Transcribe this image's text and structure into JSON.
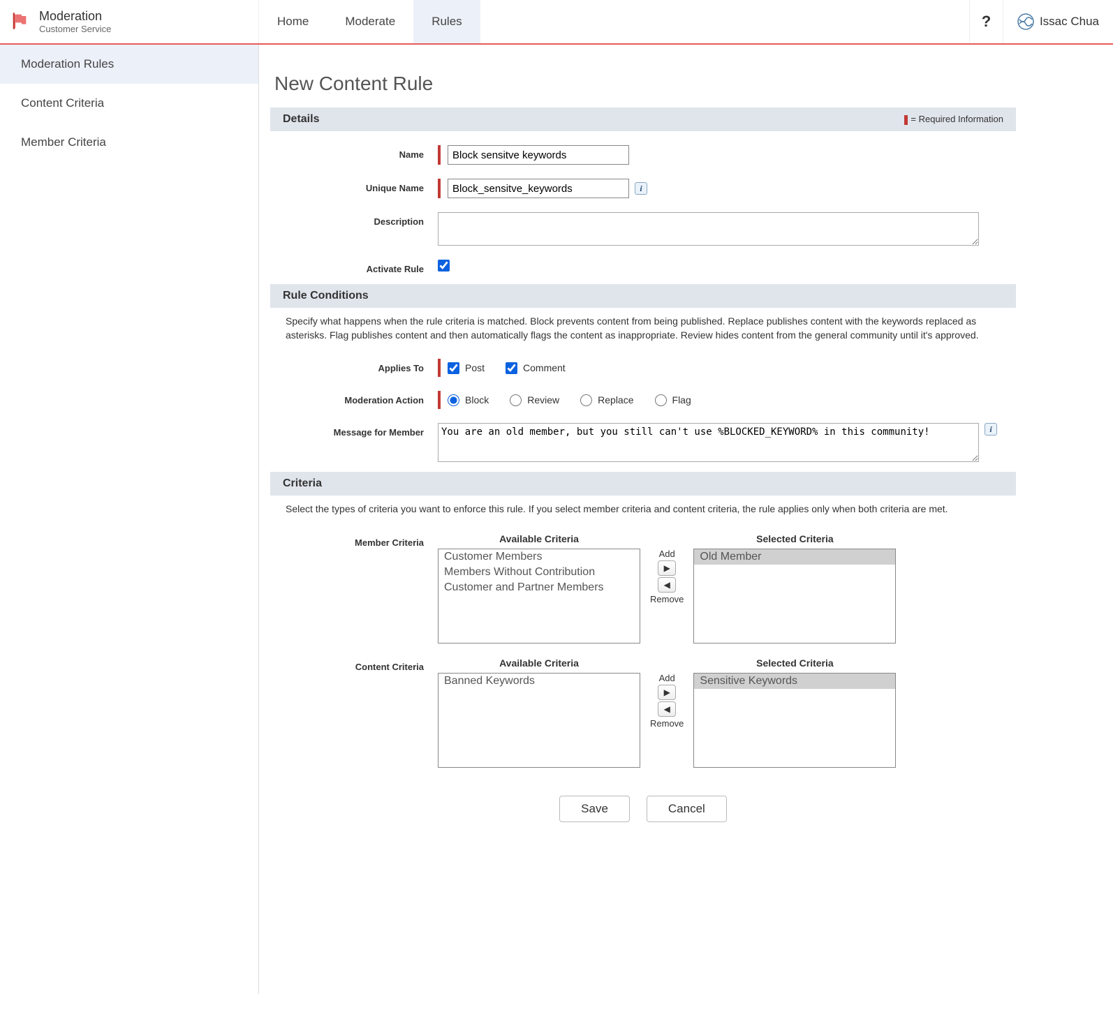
{
  "header": {
    "brand_title": "Moderation",
    "brand_subtitle": "Customer Service",
    "nav": [
      "Home",
      "Moderate",
      "Rules"
    ],
    "active_nav": 2,
    "help": "?",
    "user_name": "Issac Chua"
  },
  "sidebar": {
    "items": [
      {
        "label": "Moderation Rules"
      },
      {
        "label": "Content Criteria"
      },
      {
        "label": "Member Criteria"
      }
    ],
    "active": 0
  },
  "page": {
    "title": "New Content Rule",
    "required_note": "= Required Information"
  },
  "details": {
    "section_title": "Details",
    "name_label": "Name",
    "name_value": "Block sensitve keywords",
    "unique_label": "Unique Name",
    "unique_value": "Block_sensitve_keywords",
    "description_label": "Description",
    "description_value": "",
    "activate_label": "Activate Rule",
    "activate_checked": true
  },
  "conditions": {
    "section_title": "Rule Conditions",
    "help_text": "Specify what happens when the rule criteria is matched. Block prevents content from being published. Replace publishes content with the keywords replaced as asterisks. Flag publishes content and then automatically flags the content as inappropriate. Review hides content from the general community until it's approved.",
    "applies_label": "Applies To",
    "applies_post_label": "Post",
    "applies_post_checked": true,
    "applies_comment_label": "Comment",
    "applies_comment_checked": true,
    "action_label": "Moderation Action",
    "action_options": [
      "Block",
      "Review",
      "Replace",
      "Flag"
    ],
    "action_selected": "Block",
    "message_label": "Message for Member",
    "message_value": "You are an old member, but you still can't use %BLOCKED_KEYWORD% in this community!"
  },
  "criteria": {
    "section_title": "Criteria",
    "help_text": "Select the types of criteria you want to enforce this rule. If you select member criteria and content criteria, the rule applies only when both criteria are met.",
    "member_label": "Member Criteria",
    "content_label": "Content Criteria",
    "available_title": "Available Criteria",
    "selected_title": "Selected Criteria",
    "add_label": "Add",
    "remove_label": "Remove",
    "member_available": [
      "Customer Members",
      "Members Without Contribution",
      "Customer and Partner Members"
    ],
    "member_selected": [
      "Old Member"
    ],
    "content_available": [
      "Banned Keywords"
    ],
    "content_selected": [
      "Sensitive Keywords"
    ]
  },
  "footer": {
    "save": "Save",
    "cancel": "Cancel"
  }
}
